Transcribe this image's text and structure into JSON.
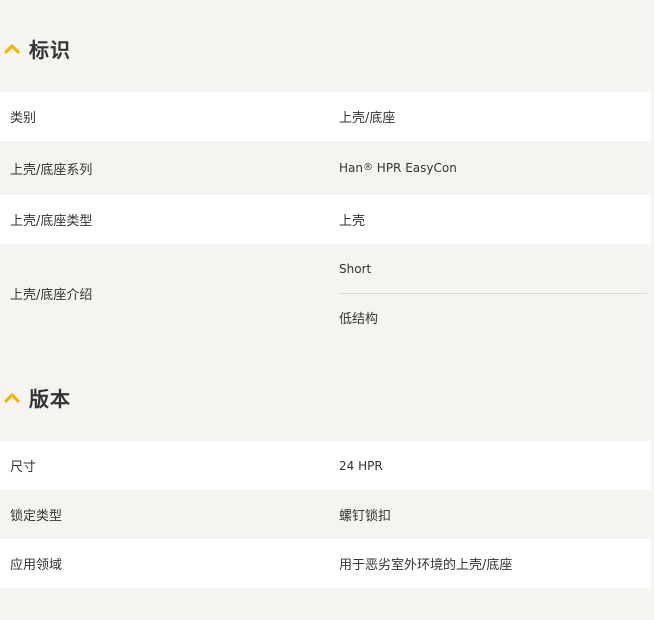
{
  "colors": {
    "accent": "#f2b705",
    "background": "#f5f4f1",
    "row_white": "#ffffff",
    "text": "#333333"
  },
  "identification": {
    "title": "标识",
    "icon": "chevron-up-icon",
    "rows": [
      {
        "label": "类别",
        "value": "上壳/底座"
      },
      {
        "label": "上壳/底座系列",
        "value_prefix": "Han",
        "value_sup": "®",
        "value_suffix": " HPR EasyCon"
      },
      {
        "label": "上壳/底座类型",
        "value": "上壳"
      },
      {
        "label": "上壳/底座介绍",
        "values": [
          "Short",
          "低结构"
        ]
      }
    ]
  },
  "version": {
    "title": "版本",
    "icon": "chevron-up-icon",
    "rows": [
      {
        "label": "尺寸",
        "value": "24 HPR"
      },
      {
        "label": "锁定类型",
        "value": "螺钉锁扣"
      },
      {
        "label": "应用领域",
        "value": "用于恶劣室外环境的上壳/底座"
      }
    ]
  }
}
